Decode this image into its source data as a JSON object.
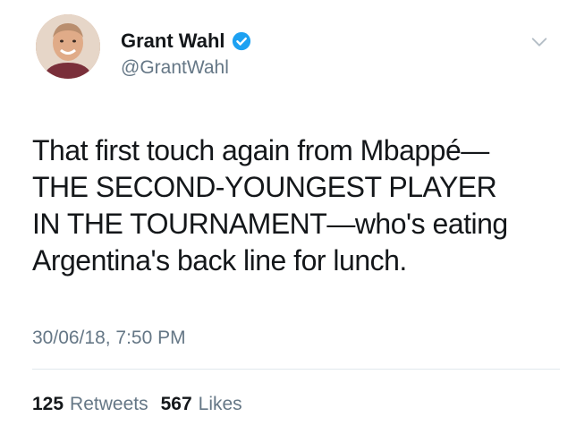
{
  "author": {
    "name": "Grant Wahl",
    "handle": "@GrantWahl",
    "verified": true
  },
  "tweet": {
    "lines": [
      "That first touch again from Mbappé—",
      "THE SECOND-YOUNGEST PLAYER",
      "IN THE TOURNAMENT—who's eating",
      "Argentina's back line for lunch."
    ],
    "timestamp": "30/06/18, 7:50 PM"
  },
  "stats": {
    "retweets_count": "125",
    "retweets_label": "Retweets",
    "likes_count": "567",
    "likes_label": "Likes"
  },
  "colors": {
    "verified_badge": "#1da1f2",
    "secondary_text": "#657786",
    "primary_text": "#14171a",
    "divider": "#e1e8ed"
  },
  "icons": {
    "verified": "verified-badge-icon",
    "menu": "chevron-down-icon"
  }
}
